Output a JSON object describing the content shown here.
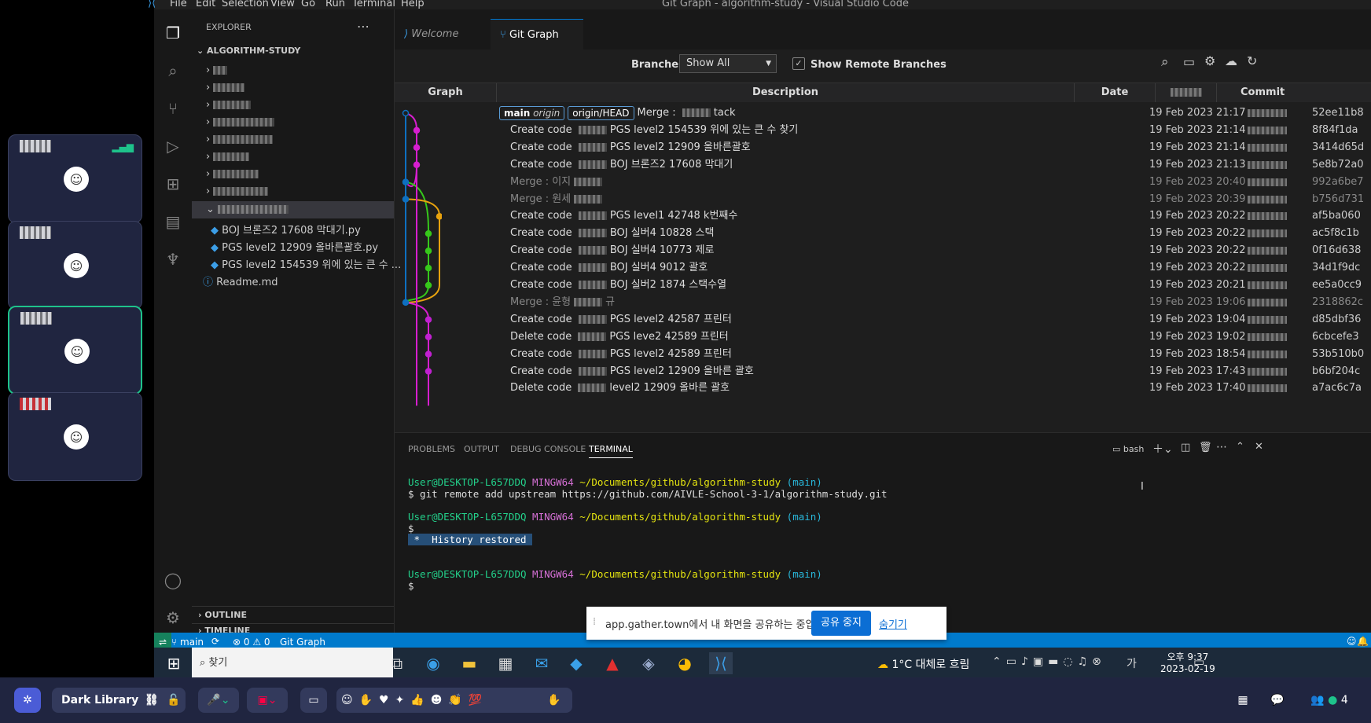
{
  "window_title": "Git Graph - algorithm-study - Visual Studio Code",
  "menu": [
    "File",
    "Edit",
    "Selection",
    "View",
    "Go",
    "Run",
    "Terminal",
    "Help"
  ],
  "explorer": {
    "header": "EXPLORER",
    "root": "ALGORITHM-STUDY",
    "files": [
      "BOJ 브론즈2 17608 막대기.py",
      "PGS level2 12909 올바른괄호.py",
      "PGS level2 154539 위에 있는 큰 수 ..."
    ],
    "readme": "Readme.md",
    "outline": "OUTLINE",
    "timeline": "TIMELINE"
  },
  "tabs": {
    "welcome": "Welcome",
    "gitgraph": "Git Graph"
  },
  "toolbar": {
    "branches_label": "Branches:",
    "branches_value": "Show All",
    "remote_label": "Show Remote Branches"
  },
  "table_headers": {
    "graph": "Graph",
    "description": "Description",
    "date": "Date",
    "commit": "Commit"
  },
  "refs": {
    "main": "main",
    "origin": "origin",
    "head": "origin/HEAD"
  },
  "commits": [
    {
      "desc": "Merge : ",
      "tail": "tack",
      "date": "19 Feb 2023 21:17",
      "hash": "52ee11b8",
      "dim": false,
      "refs": true
    },
    {
      "desc": "Create code ",
      "tail": "PGS level2 154539 위에 있는 큰 수 찾기",
      "date": "19 Feb 2023 21:14",
      "hash": "8f84f1da",
      "dim": false
    },
    {
      "desc": "Create code ",
      "tail": "PGS level2 12909 올바른괄호",
      "date": "19 Feb 2023 21:14",
      "hash": "3414d65d",
      "dim": false
    },
    {
      "desc": "Create code ",
      "tail": "BOJ 브론즈2 17608 막대기",
      "date": "19 Feb 2023 21:13",
      "hash": "5e8b72a0",
      "dim": false
    },
    {
      "desc": "Merge : 이지",
      "tail": "",
      "date": "19 Feb 2023 20:40",
      "hash": "992a6be7",
      "dim": true
    },
    {
      "desc": "Merge : 원세",
      "tail": "",
      "date": "19 Feb 2023 20:39",
      "hash": "b756d731",
      "dim": true
    },
    {
      "desc": "Create code ",
      "tail": "PGS level1 42748 k번째수",
      "date": "19 Feb 2023 20:22",
      "hash": "af5ba060",
      "dim": false
    },
    {
      "desc": "Create code ",
      "tail": "BOJ 실버4 10828 스택",
      "date": "19 Feb 2023 20:22",
      "hash": "ac5f8c1b",
      "dim": false
    },
    {
      "desc": "Create code ",
      "tail": "BOJ 실버4 10773 제로",
      "date": "19 Feb 2023 20:22",
      "hash": "0f16d638",
      "dim": false
    },
    {
      "desc": "Create code ",
      "tail": "BOJ 실버4 9012 괄호",
      "date": "19 Feb 2023 20:22",
      "hash": "34d1f9dc",
      "dim": false
    },
    {
      "desc": "Create code ",
      "tail": "BOJ 실버2 1874 스택수열",
      "date": "19 Feb 2023 20:21",
      "hash": "ee5a0cc9",
      "dim": false
    },
    {
      "desc": "Merge : 윤형",
      "tail": "규",
      "date": "19 Feb 2023 19:06",
      "hash": "2318862c",
      "dim": true
    },
    {
      "desc": "Create code ",
      "tail": "PGS level2 42587 프린터",
      "date": "19 Feb 2023 19:04",
      "hash": "d85dbf36",
      "dim": false
    },
    {
      "desc": "Delete code ",
      "tail": "PGS leve2 42589 프린터",
      "date": "19 Feb 2023 19:02",
      "hash": "6cbcefe3",
      "dim": false
    },
    {
      "desc": "Create code ",
      "tail": "PGS level2 42589 프린터",
      "date": "19 Feb 2023 18:54",
      "hash": "53b510b0",
      "dim": false
    },
    {
      "desc": "Create code ",
      "tail": "PGS level2 12909 올바른 괄호",
      "date": "19 Feb 2023 17:43",
      "hash": "b6bf204c",
      "dim": false
    },
    {
      "desc": "Delete code ",
      "tail": "level2 12909 올바른 괄호",
      "date": "19 Feb 2023 17:40",
      "hash": "a7ac6c7a",
      "dim": false
    }
  ],
  "panel_tabs": [
    "PROBLEMS",
    "OUTPUT",
    "DEBUG CONSOLE",
    "TERMINAL"
  ],
  "shell": "bash",
  "terminal": {
    "prompt_user": "User@DESKTOP-L657DDQ",
    "prompt_env": "MINGW64",
    "prompt_path": "~/Documents/github/algorithm-study",
    "prompt_branch": "(main)",
    "cmd1": "$ git remote add upstream https://github.com/AIVLE-School-3-1/algorithm-study.git",
    "dollar": "$",
    "history": " *  History restored "
  },
  "statusbar": {
    "branch": "main",
    "problems": "0",
    "warnings": "0",
    "gitgraph": "Git Graph"
  },
  "share_banner": {
    "text": "app.gather.town에서 내 화면을 공유하는 중입니다.",
    "stop": "공유 중지",
    "hide": "숨기기"
  },
  "taskbar": {
    "search": "찾기",
    "weather": "1°C 대체로 흐림",
    "time": "오후 9:37",
    "date": "2023-02-19"
  },
  "gather": {
    "room": "Dark Library",
    "participants": "4"
  },
  "colors": {
    "accent": "#007acc",
    "graph_blue": "#0e70c0",
    "graph_pink": "#d71ecf",
    "graph_green": "#36c81b",
    "graph_orange": "#e8a20e",
    "gather_bg": "#202540"
  }
}
